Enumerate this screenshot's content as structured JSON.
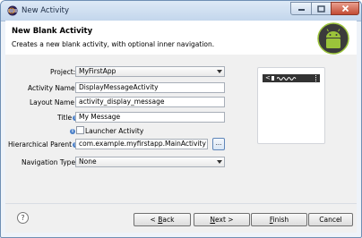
{
  "window": {
    "title": "New Activity"
  },
  "header": {
    "title": "New Blank Activity",
    "description": "Creates a new blank activity, with optional inner navigation."
  },
  "form": {
    "project": {
      "label": "Project:",
      "value": "MyFirstApp"
    },
    "activity_name": {
      "label": "Activity Name",
      "value": "DisplayMessageActivity"
    },
    "layout_name": {
      "label": "Layout Name",
      "value": "activity_display_message"
    },
    "title": {
      "label": "Title",
      "value": "My Message"
    },
    "launcher": {
      "label": "Launcher Activity",
      "checked": false
    },
    "hierarchical_parent": {
      "label": "Hierarchical Parent",
      "value": "com.example.myfirstapp.MainActivity",
      "browse_label": "..."
    },
    "navigation_type": {
      "label": "Navigation Type",
      "value": "None"
    }
  },
  "buttons": {
    "back_mnemonic": "B",
    "back_rest": "ack",
    "next_mnemonic": "N",
    "next_rest": "ext >",
    "finish_mnemonic": "F",
    "finish_rest": "inish",
    "cancel": "Cancel",
    "help": "?"
  },
  "icons": {
    "window": "eclipse-icon",
    "logo": "android-logo",
    "info": "i",
    "back_prefix": "< ",
    "preview_back": "<"
  },
  "colors": {
    "accent": "#4b80c8",
    "android_green": "#9bc43a",
    "close": "#c34b33"
  }
}
